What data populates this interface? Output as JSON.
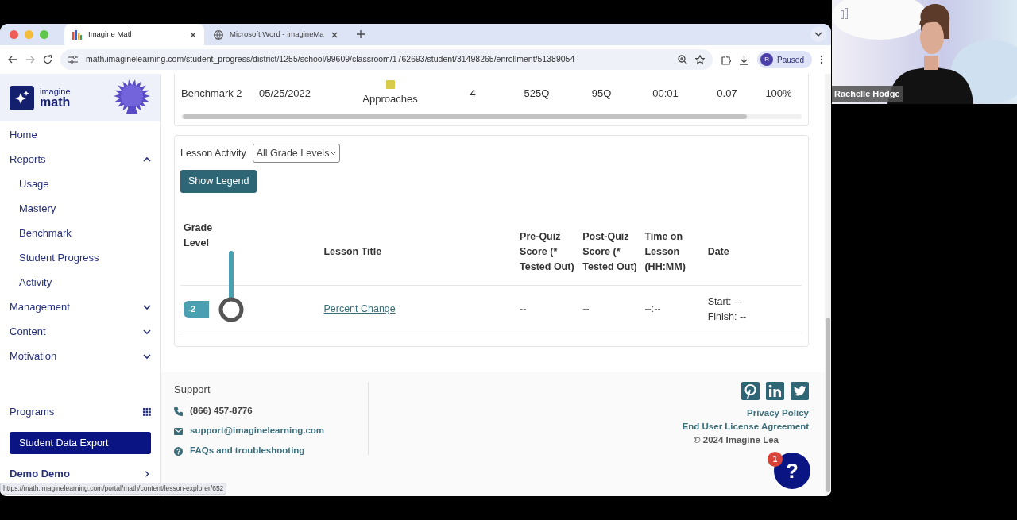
{
  "video": {
    "name": "Rachelle Hodge"
  },
  "browser": {
    "tabs": [
      {
        "title": "Imagine Math",
        "selected": true,
        "kind": "app"
      },
      {
        "title": "Microsoft Word - imagineMa",
        "selected": false,
        "kind": "web"
      }
    ],
    "url": "math.imaginelearning.com/student_progress/district/1255/school/99609/classroom/1762693/student/31498265/enrollment/51389054",
    "profile": {
      "initial": "R",
      "status": "Paused"
    },
    "status_url": "https://math.imaginelearning.com/portal/math/content/lesson-explorer/652"
  },
  "sidebar": {
    "logo": {
      "line_1": "imagine",
      "line_2": "math"
    },
    "nav": [
      {
        "label": "Home"
      },
      {
        "label": "Reports",
        "expanded": true,
        "children": [
          {
            "label": "Usage"
          },
          {
            "label": "Mastery"
          },
          {
            "label": "Benchmark"
          },
          {
            "label": "Student Progress"
          },
          {
            "label": "Activity"
          }
        ]
      },
      {
        "label": "Management",
        "expanded": false
      },
      {
        "label": "Content",
        "expanded": false
      },
      {
        "label": "Motivation",
        "expanded": false
      }
    ],
    "programs": "Programs",
    "export_button": "Student Data Export",
    "user": "Demo Demo"
  },
  "benchmark_row": {
    "cells": [
      "Benchmark 2",
      "05/25/2022",
      "Approaches",
      "4",
      "525Q",
      "95Q",
      "00:01",
      "0.07",
      "100%"
    ],
    "marker": {
      "color": "#d8cb4c"
    }
  },
  "lesson_activity": {
    "label": "Lesson Activity",
    "filter": "All Grade Levels",
    "legend_button": "Show Legend",
    "columns": [
      "Grade Level",
      "Lesson Title",
      "Pre-Quiz Score (* Tested Out)",
      "Post-Quiz Score (* Tested Out)",
      "Time on Lesson (HH:MM)",
      "Date"
    ],
    "rows": [
      {
        "grade": "-2",
        "title": "Percent Change",
        "pre_quiz": "--",
        "post_quiz": "--",
        "time": "--:--",
        "start": "Start: --",
        "finish": "Finish: --"
      }
    ]
  },
  "footer": {
    "title": "Support",
    "contacts": [
      {
        "kind": "phone",
        "text": "(866) 457-8776"
      },
      {
        "kind": "email",
        "text": "support@imaginelearning.com"
      },
      {
        "kind": "help",
        "text": "FAQs and troubleshooting"
      }
    ],
    "links": [
      "Privacy Policy",
      "End User License Agreement"
    ],
    "copyright": "© 2024 Imagine Lea"
  },
  "help": {
    "symbol": "?",
    "badge": "1"
  }
}
